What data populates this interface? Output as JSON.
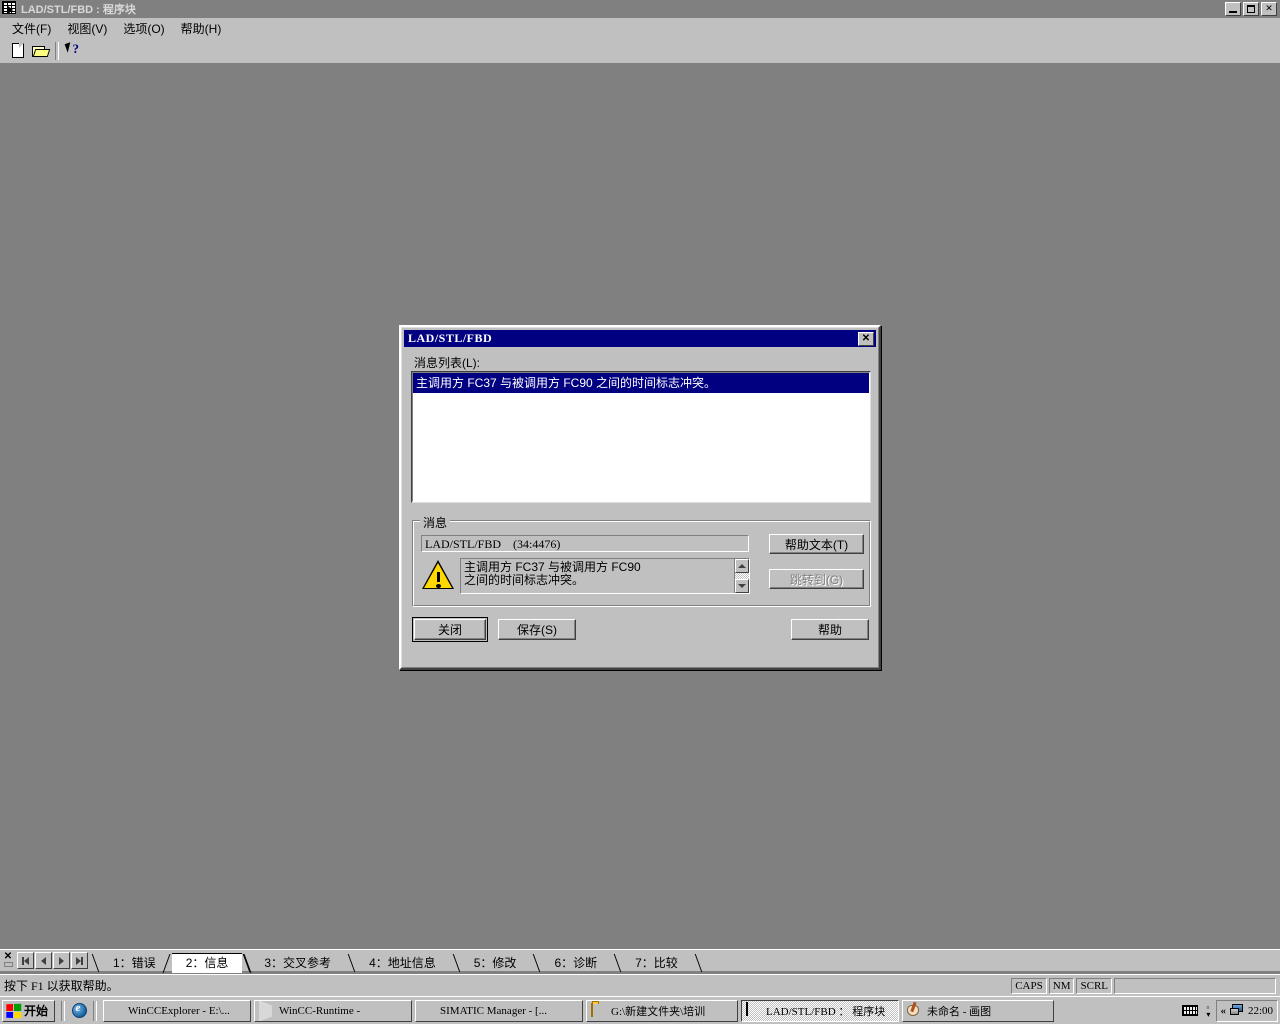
{
  "window": {
    "title": "LAD/STL/FBD : 程序块",
    "icon": "ladder-logic-icon",
    "controls": {
      "minimize": "minimize",
      "maximize": "maximize",
      "close": "✕"
    }
  },
  "menubar": {
    "items": [
      {
        "label": "文件(F)",
        "name": "menu-file"
      },
      {
        "label": "视图(V)",
        "name": "menu-view"
      },
      {
        "label": "选项(O)",
        "name": "menu-options"
      },
      {
        "label": "帮助(H)",
        "name": "menu-help"
      }
    ]
  },
  "toolbar": {
    "buttons": [
      {
        "icon": "new-document-icon",
        "name": "toolbar-new"
      },
      {
        "icon": "open-folder-icon",
        "name": "toolbar-open"
      },
      {
        "icon": "context-help-icon",
        "name": "toolbar-context-help"
      }
    ]
  },
  "dialog": {
    "title": "LAD/STL/FBD",
    "close_label": "✕",
    "list_label": "消息列表(L):",
    "list_items": [
      "主调用方 FC37 与被调用方 FC90 之间的时间标志冲突。"
    ],
    "selected_index": 0,
    "group": {
      "title": "消息",
      "code_field": "LAD/STL/FBD    (34:4476)",
      "message_text": "主调用方 FC37 与被调用方 FC90\n之间的时间标志冲突。",
      "icon": "warning-icon",
      "help_text_button": "帮助文本(T)",
      "goto_button": "跳转到(G)",
      "goto_disabled": true
    },
    "buttons": {
      "close": "关闭",
      "save": "保存(S)",
      "help": "帮助"
    }
  },
  "tabstrip": {
    "nav": [
      "first",
      "previous",
      "next",
      "last"
    ],
    "close_icon": "close-pane-icon",
    "active_index": 1,
    "tabs": [
      {
        "label": "1：错误",
        "name": "tab-errors"
      },
      {
        "label": "2：信息",
        "name": "tab-info"
      },
      {
        "label": "3：交叉参考",
        "name": "tab-cross-reference"
      },
      {
        "label": "4：地址信息",
        "name": "tab-address-info"
      },
      {
        "label": "5：修改",
        "name": "tab-modify"
      },
      {
        "label": "6：诊断",
        "name": "tab-diagnostics"
      },
      {
        "label": "7：比较",
        "name": "tab-compare"
      }
    ]
  },
  "statusbar": {
    "hint": "按下 F1 以获取帮助。",
    "indicators": [
      "CAPS",
      "NM",
      "SCRL"
    ]
  },
  "taskbar": {
    "start_label": "开始",
    "quicklaunch": [
      {
        "icon": "internet-explorer-icon",
        "name": "quicklaunch-ie"
      }
    ],
    "tasks": [
      {
        "label": "WinCCExplorer - E:\\...",
        "icon": "wincc-icon",
        "active": false,
        "name": "taskbutton-winccexplorer"
      },
      {
        "label": "WinCC-Runtime -",
        "icon": "wincc-runtime-icon",
        "active": false,
        "name": "taskbutton-wincc-runtime"
      },
      {
        "label": "SIMATIC Manager - [...",
        "icon": "simatic-icon",
        "active": false,
        "name": "taskbutton-simatic-manager"
      },
      {
        "label": "G:\\新建文件夹\\培训",
        "icon": "folder-icon",
        "active": false,
        "name": "taskbutton-explorer-folder"
      },
      {
        "label": "LAD/STL/FBD ： 程序块",
        "icon": "ladder-logic-icon",
        "active": true,
        "name": "taskbutton-lad-stl-fbd"
      },
      {
        "label": "未命名 - 画图",
        "icon": "paint-icon",
        "active": false,
        "name": "taskbutton-paint"
      }
    ],
    "tray": {
      "icons": [
        "keyboard-icon",
        "updown-icon",
        "chevron-left-icon",
        "network-icon"
      ],
      "chevron": "«",
      "clock": "22:00"
    }
  }
}
